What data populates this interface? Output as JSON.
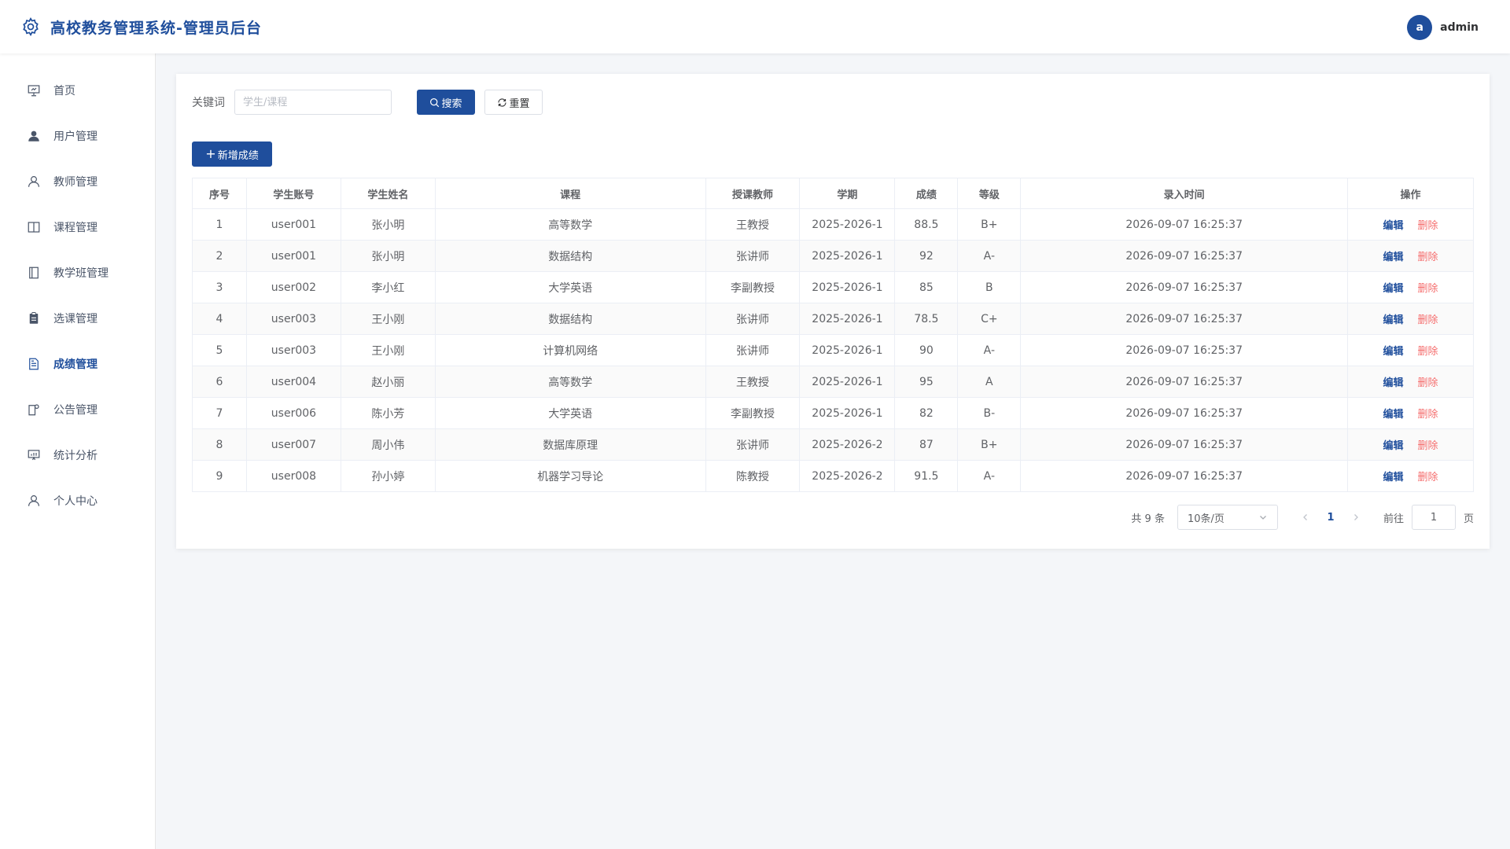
{
  "header": {
    "title": "高校教务管理系统-管理员后台",
    "avatar_letter": "a",
    "username": "admin"
  },
  "sidebar": {
    "items": [
      {
        "label": "首页",
        "icon": "presentation-icon"
      },
      {
        "label": "用户管理",
        "icon": "user-filled-icon"
      },
      {
        "label": "教师管理",
        "icon": "user-icon"
      },
      {
        "label": "课程管理",
        "icon": "book-icon"
      },
      {
        "label": "教学班管理",
        "icon": "notebook-icon"
      },
      {
        "label": "选课管理",
        "icon": "clipboard-icon"
      },
      {
        "label": "成绩管理",
        "icon": "document-icon",
        "active": true
      },
      {
        "label": "公告管理",
        "icon": "notice-icon"
      },
      {
        "label": "统计分析",
        "icon": "chart-board-icon"
      },
      {
        "label": "个人中心",
        "icon": "user-icon"
      }
    ]
  },
  "search": {
    "label": "关键词",
    "placeholder": "学生/课程",
    "search_label": "搜索",
    "reset_label": "重置"
  },
  "toolbar": {
    "add_label": "新增成绩"
  },
  "table": {
    "columns": [
      "序号",
      "学生账号",
      "学生姓名",
      "课程",
      "授课教师",
      "学期",
      "成绩",
      "等级",
      "录入时间",
      "操作"
    ],
    "rows": [
      [
        "1",
        "user001",
        "张小明",
        "高等数学",
        "王教授",
        "2025-2026-1",
        "88.5",
        "B+",
        "2026-09-07 16:25:37"
      ],
      [
        "2",
        "user001",
        "张小明",
        "数据结构",
        "张讲师",
        "2025-2026-1",
        "92",
        "A-",
        "2026-09-07 16:25:37"
      ],
      [
        "3",
        "user002",
        "李小红",
        "大学英语",
        "李副教授",
        "2025-2026-1",
        "85",
        "B",
        "2026-09-07 16:25:37"
      ],
      [
        "4",
        "user003",
        "王小刚",
        "数据结构",
        "张讲师",
        "2025-2026-1",
        "78.5",
        "C+",
        "2026-09-07 16:25:37"
      ],
      [
        "5",
        "user003",
        "王小刚",
        "计算机网络",
        "张讲师",
        "2025-2026-1",
        "90",
        "A-",
        "2026-09-07 16:25:37"
      ],
      [
        "6",
        "user004",
        "赵小丽",
        "高等数学",
        "王教授",
        "2025-2026-1",
        "95",
        "A",
        "2026-09-07 16:25:37"
      ],
      [
        "7",
        "user006",
        "陈小芳",
        "大学英语",
        "李副教授",
        "2025-2026-1",
        "82",
        "B-",
        "2026-09-07 16:25:37"
      ],
      [
        "8",
        "user007",
        "周小伟",
        "数据库原理",
        "张讲师",
        "2025-2026-2",
        "87",
        "B+",
        "2026-09-07 16:25:37"
      ],
      [
        "9",
        "user008",
        "孙小婷",
        "机器学习导论",
        "陈教授",
        "2025-2026-2",
        "91.5",
        "A-",
        "2026-09-07 16:25:37"
      ]
    ],
    "edit_label": "编辑",
    "delete_label": "删除"
  },
  "pagination": {
    "total_label": "共 9 条",
    "page_size": "10条/页",
    "current_page": "1",
    "goto_label": "前往",
    "goto_value": "1",
    "page_suffix": "页"
  },
  "colors": {
    "primary": "#1f4e9c",
    "danger": "#f56c6c",
    "background": "#f4f6f9"
  }
}
